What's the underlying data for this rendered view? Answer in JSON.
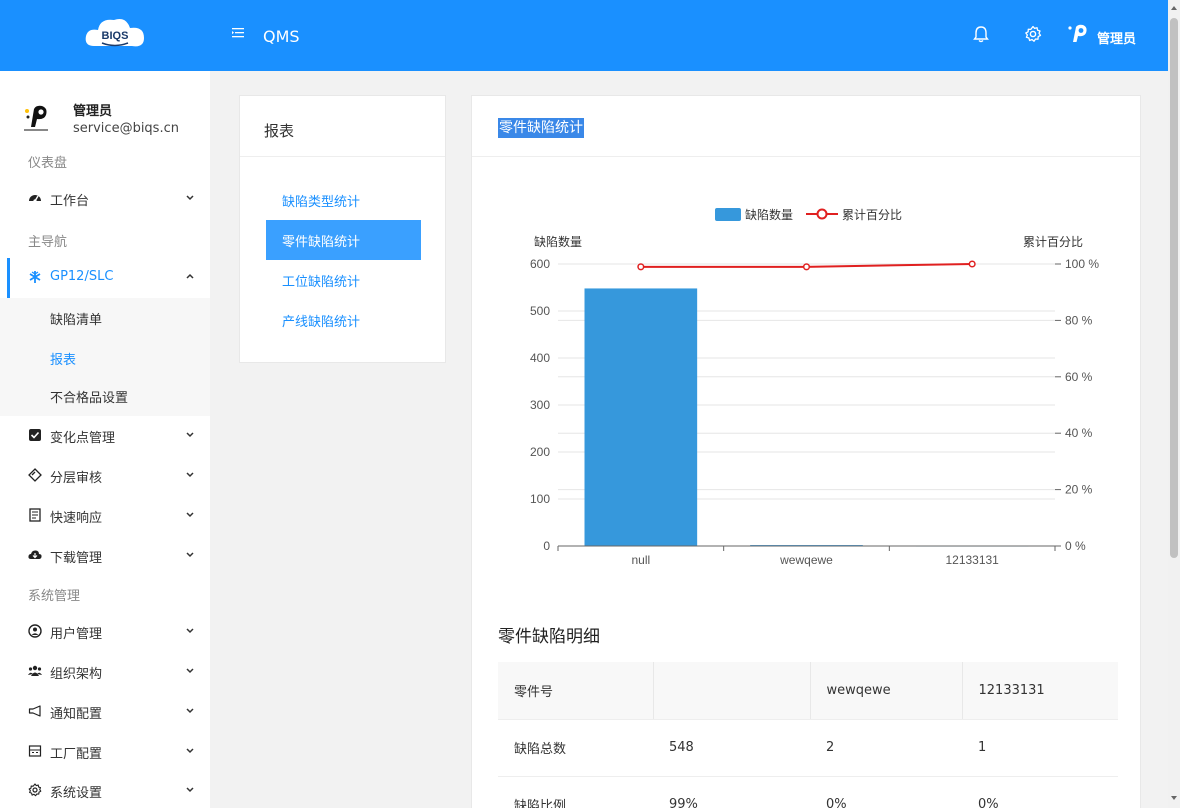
{
  "header": {
    "logo_text": "BIQS",
    "app_title": "QMS",
    "user_name": "管理员"
  },
  "sidebar": {
    "profile": {
      "name": "管理员",
      "email": "service@biqs.cn"
    },
    "section_dashboard": "仪表盘",
    "workbench": "工作台",
    "section_main_nav": "主导航",
    "gp12": "GP12/SLC",
    "sub_items": [
      "缺陷清单",
      "报表",
      "不合格品设置"
    ],
    "change_point": "变化点管理",
    "layered_audit": "分层审核",
    "quick_response": "快速响应",
    "download": "下载管理",
    "section_system": "系统管理",
    "user_mgmt": "用户管理",
    "org": "组织架构",
    "notify": "通知配置",
    "factory": "工厂配置",
    "settings": "系统设置"
  },
  "report_menu": {
    "title": "报表",
    "items": [
      "缺陷类型统计",
      "零件缺陷统计",
      "工位缺陷统计",
      "产线缺陷统计"
    ]
  },
  "main": {
    "title": "零件缺陷统计",
    "detail_title": "零件缺陷明细",
    "table": {
      "header": [
        "零件号",
        "",
        "wewqewe",
        "12133131"
      ],
      "rows": [
        [
          "缺陷总数",
          "548",
          "2",
          "1"
        ],
        [
          "缺陷比例",
          "99%",
          "0%",
          "0%"
        ]
      ]
    }
  },
  "chart_data": {
    "type": "bar",
    "categories": [
      "null",
      "wewqewe",
      "12133131"
    ],
    "series": [
      {
        "name": "缺陷数量",
        "type": "bar",
        "axis": "left",
        "values": [
          548,
          2,
          1
        ],
        "color": "#3698dc"
      },
      {
        "name": "累计百分比",
        "type": "line",
        "axis": "right",
        "values": [
          99,
          99,
          100
        ],
        "color": "#e02020"
      }
    ],
    "ylabel": "缺陷数量",
    "ylabel_right": "累计百分比",
    "ylim": [
      0,
      600
    ],
    "ylim_right": [
      0,
      100
    ],
    "y_ticks": [
      "0",
      "100",
      "200",
      "300",
      "400",
      "500",
      "600"
    ],
    "y_right_ticks": [
      "0 %",
      "20 %",
      "40 %",
      "60 %",
      "80 %",
      "100 %"
    ],
    "legend_position": "top-center",
    "grid": true
  }
}
